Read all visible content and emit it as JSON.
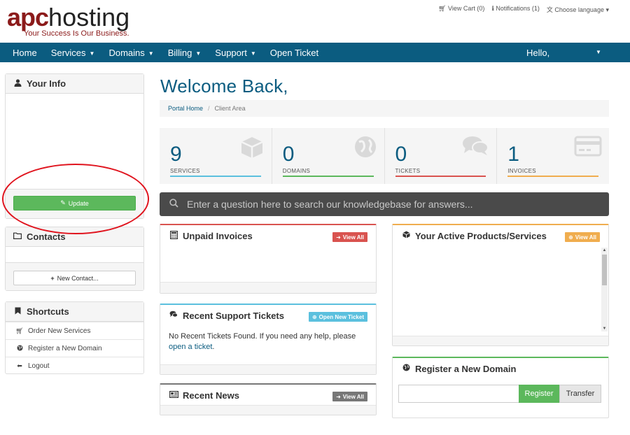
{
  "brand": {
    "logo_primary": "apc",
    "logo_secondary": "hosting",
    "tagline": "Your Success Is Our Business.",
    "primary_color": "#0b5c80",
    "accent_color": "#8b1a1a"
  },
  "topbar": {
    "cart": "View Cart (0)",
    "notifications": "Notifications (1)",
    "language": "Choose language"
  },
  "nav": {
    "items": [
      {
        "label": "Home"
      },
      {
        "label": "Services"
      },
      {
        "label": "Domains"
      },
      {
        "label": "Billing"
      },
      {
        "label": "Support"
      },
      {
        "label": "Open Ticket"
      }
    ],
    "greeting": "Hello,"
  },
  "sidebar": {
    "your_info": {
      "title": "Your Info",
      "update_label": "Update"
    },
    "contacts": {
      "title": "Contacts",
      "new_contact_label": "New Contact..."
    },
    "shortcuts": {
      "title": "Shortcuts",
      "items": [
        {
          "label": "Order New Services",
          "icon": "cart-icon"
        },
        {
          "label": "Register a New Domain",
          "icon": "globe-icon"
        },
        {
          "label": "Logout",
          "icon": "arrow-left-icon"
        }
      ]
    }
  },
  "main": {
    "title": "Welcome Back,",
    "breadcrumb": {
      "home": "Portal Home",
      "current": "Client Area"
    },
    "stats": [
      {
        "value": "9",
        "label": "SERVICES",
        "color": "#5bc0de",
        "icon": "cube-icon"
      },
      {
        "value": "0",
        "label": "DOMAINS",
        "color": "#5cb85c",
        "icon": "globe-icon"
      },
      {
        "value": "0",
        "label": "TICKETS",
        "color": "#d9534f",
        "icon": "comments-icon"
      },
      {
        "value": "1",
        "label": "INVOICES",
        "color": "#f0ad4e",
        "icon": "credit-card-icon"
      }
    ],
    "kb_search": {
      "placeholder": "Enter a question here to search our knowledgebase for answers..."
    },
    "unpaid_invoices": {
      "title": "Unpaid Invoices",
      "button": "View All",
      "color": "#d9534f"
    },
    "active_products": {
      "title": "Your Active Products/Services",
      "button": "View All",
      "color": "#f0ad4e"
    },
    "support_tickets": {
      "title": "Recent Support Tickets",
      "button": "Open New Ticket",
      "color": "#5bc0de",
      "message": "No Recent Tickets Found. If you need any help, please",
      "link": "open a ticket",
      "suffix": "."
    },
    "register_domain": {
      "title": "Register a New Domain",
      "register": "Register",
      "transfer": "Transfer",
      "color": "#5cb85c"
    },
    "recent_news": {
      "title": "Recent News",
      "button": "View All",
      "color": "#777777"
    }
  }
}
